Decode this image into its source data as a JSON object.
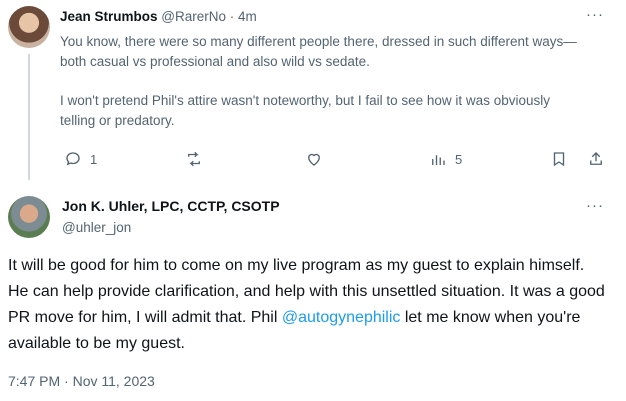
{
  "reply": {
    "author_name": "Jean Strumbos",
    "author_handle": "@RarerNo",
    "separator": "·",
    "time_ago": "4m",
    "more": "···",
    "paragraph1": "You know, there were so many different people there, dressed in such different ways—both casual vs professional and also wild vs sedate.",
    "paragraph2": "I won't pretend Phil's attire wasn't noteworthy, but I fail to see how it was obviously telling or predatory.",
    "actions": {
      "reply_icon": "comment-icon",
      "reply_count": "1",
      "retweet_icon": "retweet-icon",
      "like_icon": "heart-icon",
      "views_icon": "views-bar-chart-icon",
      "views_count": "5",
      "bookmark_icon": "bookmark-icon",
      "share_icon": "share-icon"
    }
  },
  "main_tweet": {
    "author_name": "Jon K. Uhler, LPC, CCTP, CSOTP",
    "author_handle": "@uhler_jon",
    "more": "···",
    "text_before": "It will be good for him to come on my live program as my guest to explain himself. He can help provide clarification, and help with this unsettled situation. It was a good PR move for him, I will admit that. Phil ",
    "mention": "@autogynephilic",
    "text_after": " let me know when you're available to be my guest.",
    "timestamp": "7:47 PM · Nov 11, 2023"
  },
  "colors": {
    "accent": "#1d9bf0",
    "muted": "#536471",
    "text": "#0f1419"
  }
}
